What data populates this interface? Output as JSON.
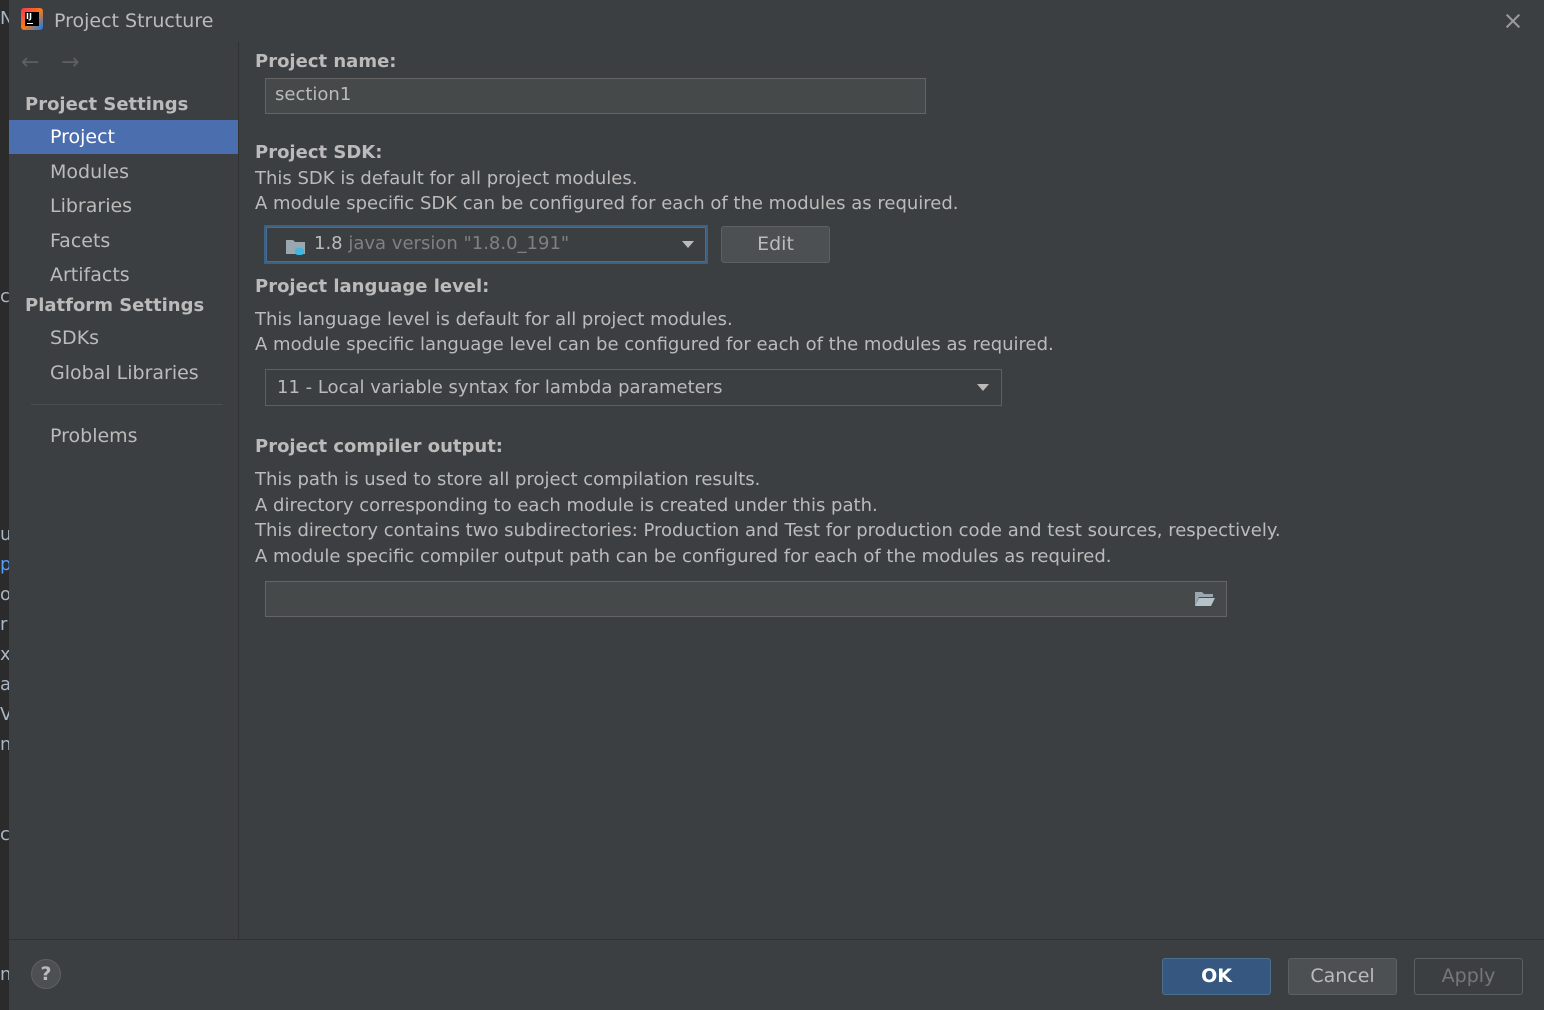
{
  "window": {
    "title": "Project Structure",
    "app_icon": "intellij-idea-icon",
    "close_icon": "close-icon"
  },
  "nav": {
    "back_icon": "←",
    "forward_icon": "→"
  },
  "sidebar": {
    "project_settings_header": "Project Settings",
    "project_settings_items": [
      {
        "label": "Project",
        "selected": true
      },
      {
        "label": "Modules",
        "selected": false
      },
      {
        "label": "Libraries",
        "selected": false
      },
      {
        "label": "Facets",
        "selected": false
      },
      {
        "label": "Artifacts",
        "selected": false
      }
    ],
    "platform_settings_header": "Platform Settings",
    "platform_settings_items": [
      {
        "label": "SDKs"
      },
      {
        "label": "Global Libraries"
      }
    ],
    "problems_label": "Problems",
    "selected_color": "#4b6eaf"
  },
  "project_name": {
    "label": "Project name:",
    "value": "section1"
  },
  "project_sdk": {
    "label": "Project SDK:",
    "desc_line1": "This SDK is default for all project modules.",
    "desc_line2": "A module specific SDK can be configured for each of the modules as required.",
    "selected_version": "1.8",
    "selected_detail": "java version \"1.8.0_191\"",
    "icon": "jdk-folder-icon",
    "edit_button": "Edit"
  },
  "language_level": {
    "label": "Project language level:",
    "desc_line1": "This language level is default for all project modules.",
    "desc_line2": "A module specific language level can be configured for each of the modules as required.",
    "selected": "11 - Local variable syntax for lambda parameters"
  },
  "compiler_output": {
    "label": "Project compiler output:",
    "desc_line1": "This path is used to store all project compilation results.",
    "desc_line2": "A directory corresponding to each module is created under this path.",
    "desc_line3": "This directory contains two subdirectories: Production and Test for production code and test sources, respectively.",
    "desc_line4": "A module specific compiler output path can be configured for each of the modules as required.",
    "value": "",
    "browse_icon": "folder-open-icon"
  },
  "footer": {
    "help_label": "?",
    "ok_label": "OK",
    "cancel_label": "Cancel",
    "apply_label": "Apply"
  }
}
